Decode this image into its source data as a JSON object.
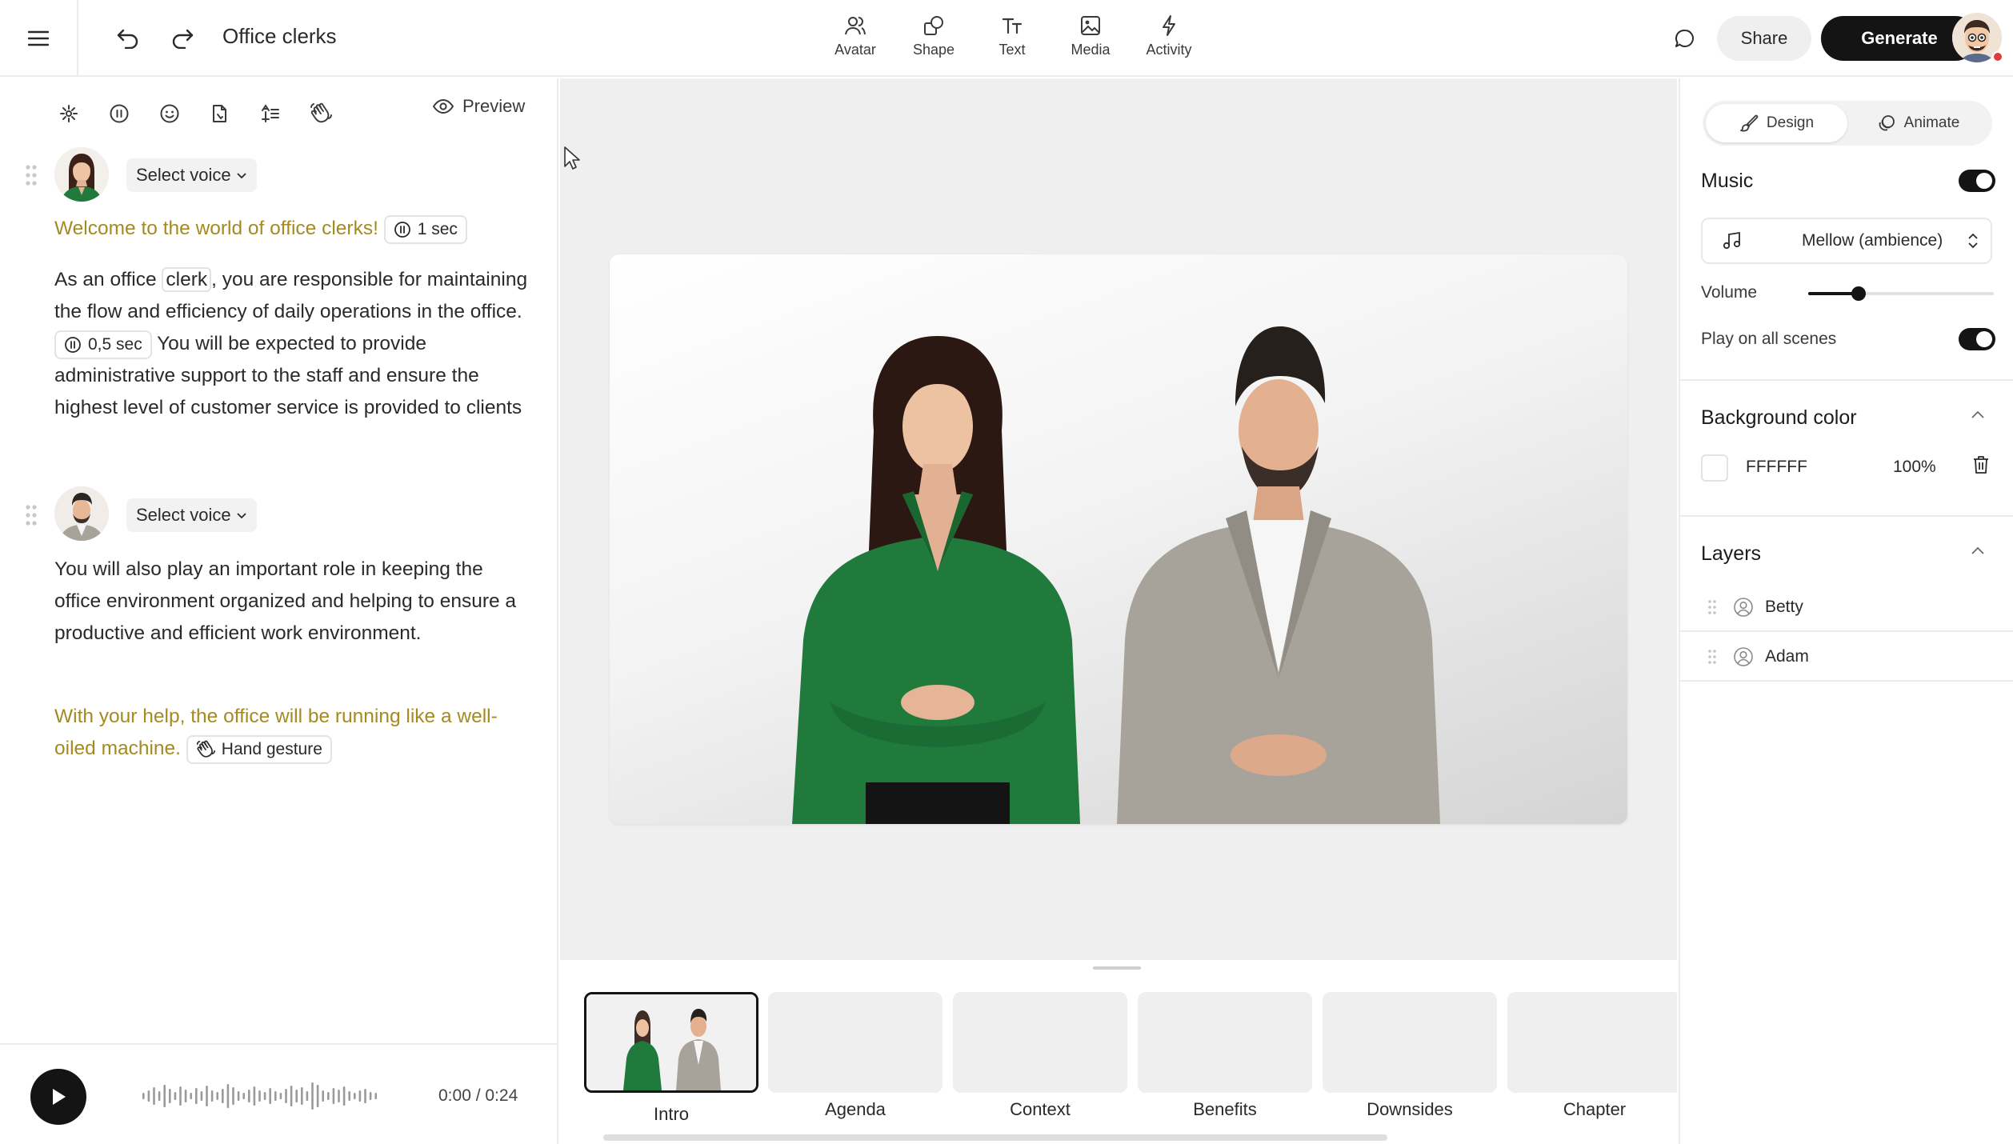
{
  "app": {
    "title": "Office clerks"
  },
  "toolbar": {
    "tools": [
      {
        "label": "Avatar",
        "icon": "avatar-icon"
      },
      {
        "label": "Shape",
        "icon": "shape-icon"
      },
      {
        "label": "Text",
        "icon": "text-icon"
      },
      {
        "label": "Media",
        "icon": "media-icon"
      },
      {
        "label": "Activity",
        "icon": "activity-icon"
      }
    ],
    "share_label": "Share",
    "generate_label": "Generate"
  },
  "script": {
    "preview_label": "Preview",
    "speakers": [
      {
        "voice_label": "Select voice",
        "segments": {
          "intro_highlight": "Welcome to the world of office clerks!",
          "pause_1": "1 sec",
          "text_a": "As an office ",
          "boxed_word": "clerk",
          "text_b": ", you are responsible for maintaining the flow and efficiency of daily operations in the office. ",
          "pause_2": "0,5 sec",
          "text_c": " You will be expected to provide administrative support to the staff and ensure the highest level of customer service is provided to clients"
        }
      },
      {
        "voice_label": "Select voice",
        "segments": {
          "text_a": "You will also play an important role in keeping the office environment organized and helping to ensure a productive and efficient work environment.",
          "outro_highlight": "With your help, the office will be running like a well-oiled machine.",
          "gesture": "Hand gesture"
        }
      }
    ]
  },
  "player": {
    "time": "0:00 / 0:24"
  },
  "scenes": [
    {
      "label": "Intro",
      "active": true
    },
    {
      "label": "Agenda",
      "active": false
    },
    {
      "label": "Context",
      "active": false
    },
    {
      "label": "Benefits",
      "active": false
    },
    {
      "label": "Downsides",
      "active": false
    },
    {
      "label": "Chapter",
      "active": false
    }
  ],
  "properties": {
    "tabs": [
      {
        "label": "Design",
        "active": true
      },
      {
        "label": "Animate",
        "active": false
      }
    ],
    "music": {
      "heading": "Music",
      "enabled": true,
      "track": "Mellow (ambience)",
      "volume_label": "Volume",
      "volume_level": 0.27,
      "play_all_label": "Play on all scenes",
      "play_all_enabled": true
    },
    "background": {
      "heading": "Background color",
      "hex": "FFFFFF",
      "opacity": "100%"
    },
    "layers": {
      "heading": "Layers",
      "items": [
        "Betty",
        "Adam"
      ]
    }
  },
  "colors": {
    "accent_dark": "#141414",
    "highlight_text": "#a58a22",
    "betty_blouse": "#1f7a3c",
    "adam_jacket": "#a8a39a"
  }
}
